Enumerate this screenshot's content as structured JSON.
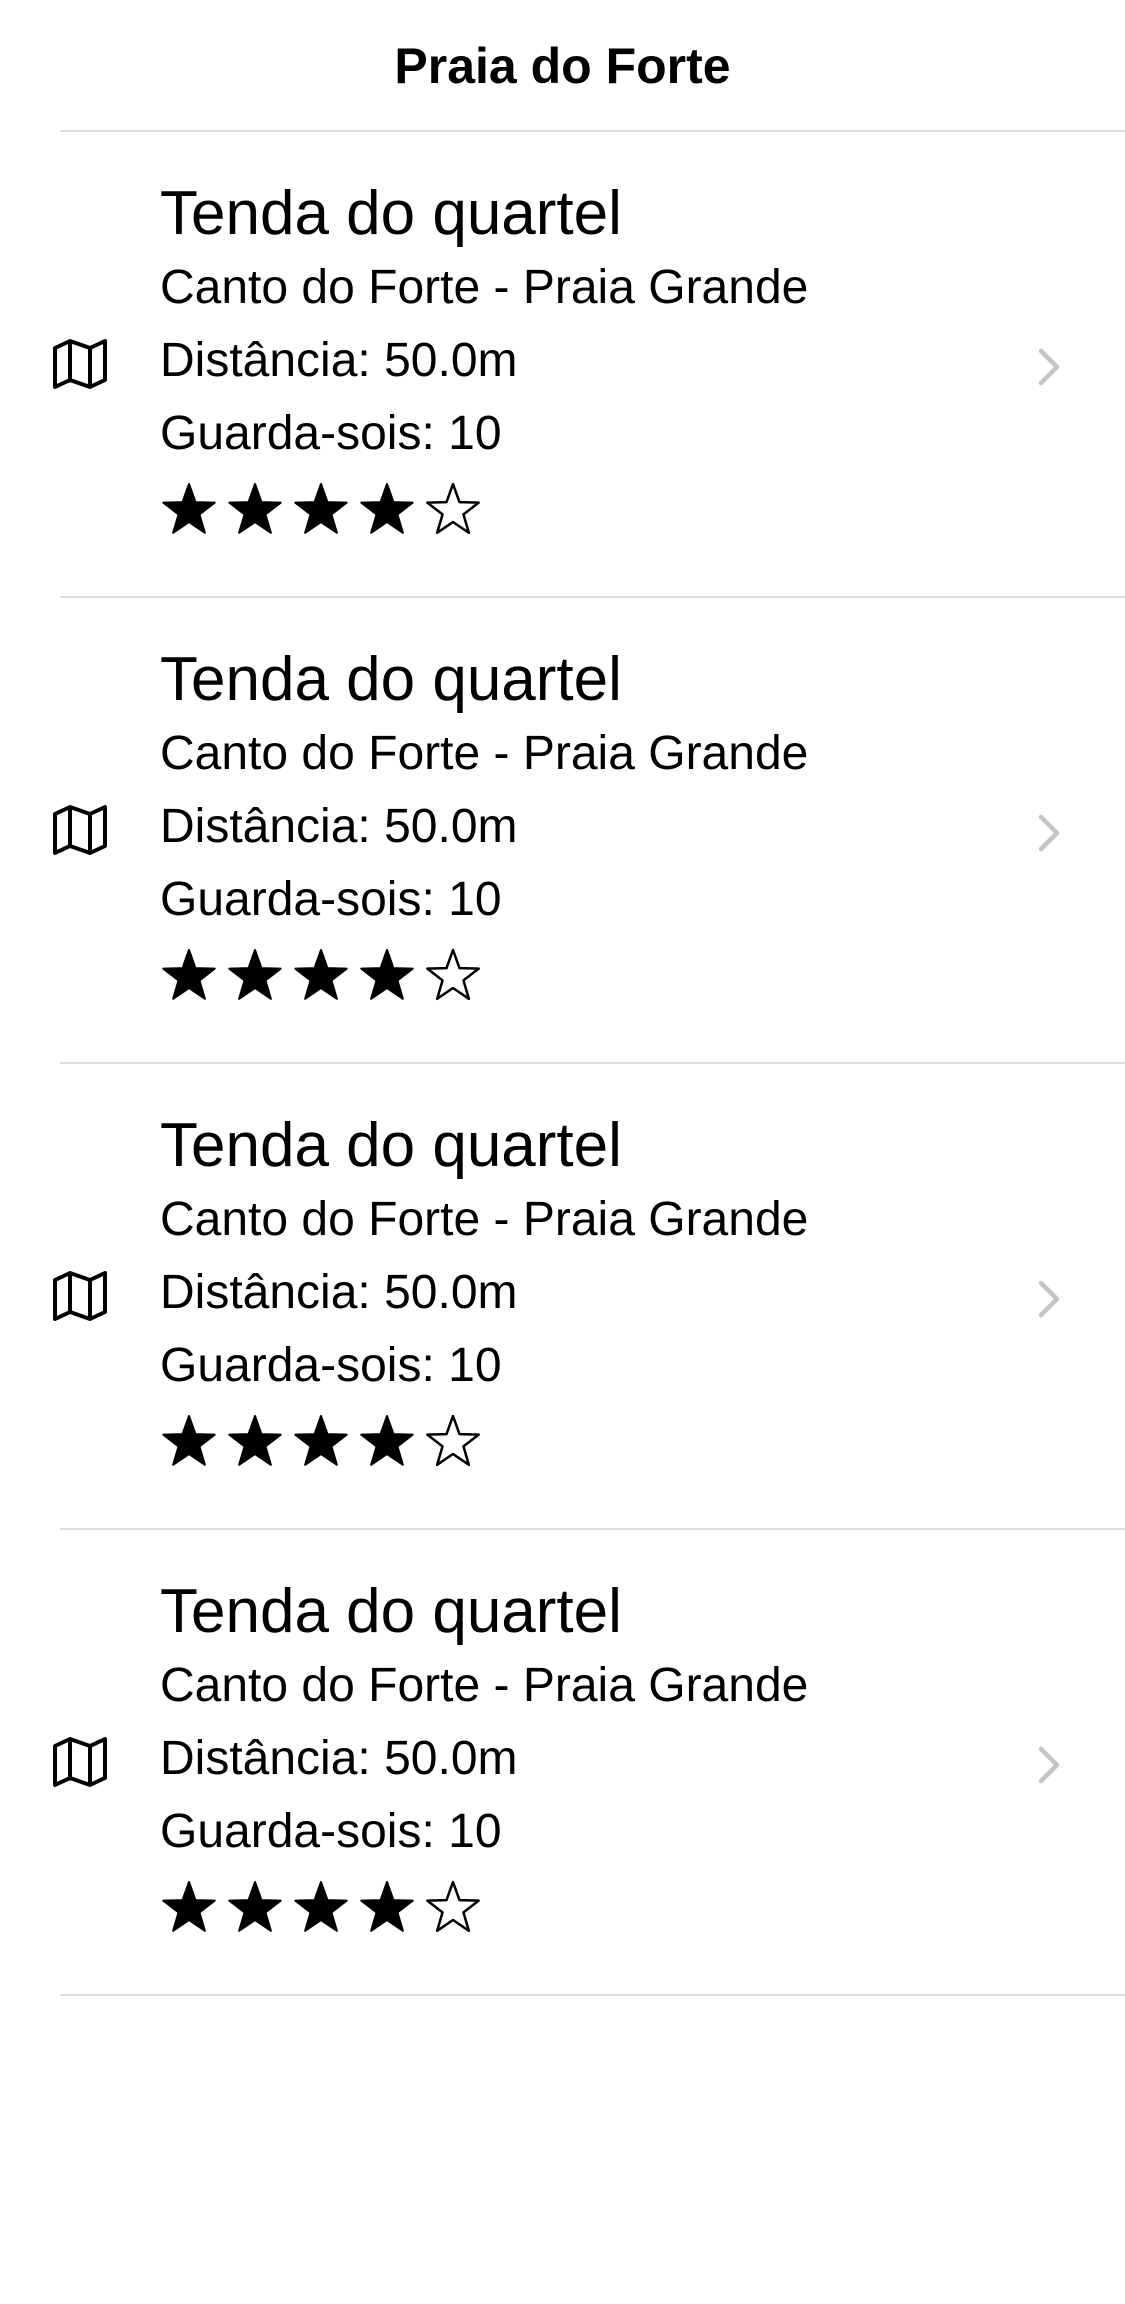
{
  "nav": {
    "title": "Praia do Forte"
  },
  "items": [
    {
      "title": "Tenda do quartel",
      "location": "Canto do Forte - Praia Grande",
      "distance": "Distância: 50.0m",
      "umbrellas": "Guarda-sois: 10",
      "rating": 4,
      "rating_max": 5,
      "icon": "map-icon",
      "accessory": "chevron-right-icon"
    },
    {
      "title": "Tenda do quartel",
      "location": "Canto do Forte - Praia Grande",
      "distance": "Distância: 50.0m",
      "umbrellas": "Guarda-sois: 10",
      "rating": 4,
      "rating_max": 5,
      "icon": "map-icon",
      "accessory": "chevron-right-icon"
    },
    {
      "title": "Tenda do quartel",
      "location": "Canto do Forte - Praia Grande",
      "distance": "Distância: 50.0m",
      "umbrellas": "Guarda-sois: 10",
      "rating": 4,
      "rating_max": 5,
      "icon": "map-icon",
      "accessory": "chevron-right-icon"
    },
    {
      "title": "Tenda do quartel",
      "location": "Canto do Forte - Praia Grande",
      "distance": "Distância: 50.0m",
      "umbrellas": "Guarda-sois: 10",
      "rating": 4,
      "rating_max": 5,
      "icon": "map-icon",
      "accessory": "chevron-right-icon"
    }
  ],
  "colors": {
    "text": "#000000",
    "separator": "#dcdcdc",
    "chevron": "#c4c4c7",
    "background": "#ffffff"
  }
}
